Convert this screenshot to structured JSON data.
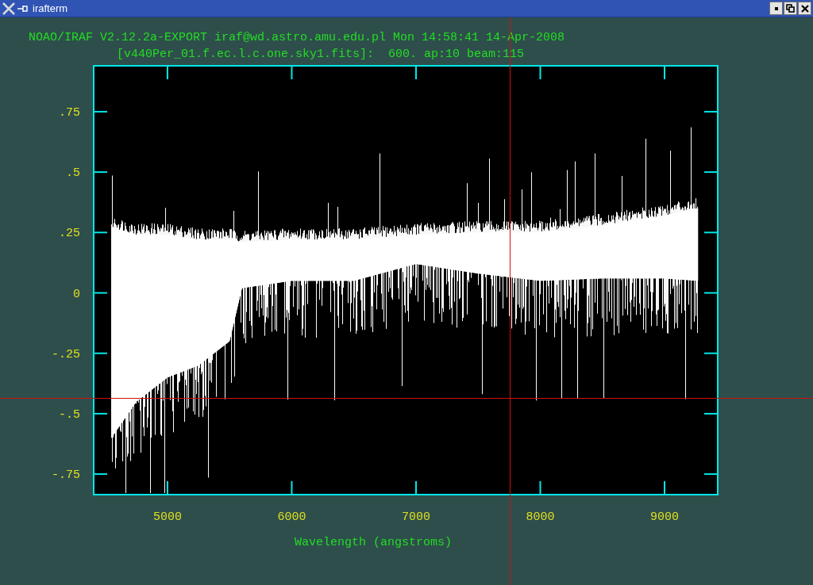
{
  "window": {
    "title": "irafterm"
  },
  "header": {
    "line_1": "NOAO/IRAF V2.12.2a-EXPORT iraf@wd.astro.amu.edu.pl Mon 14:58:41 14-Apr-2008",
    "line_2": "[v440Per_01.f.ec.l.c.one.sky1.fits]:  600. ap:10 beam:115"
  },
  "plot": {
    "chart_data": {
      "type": "line",
      "xlabel": "Wavelength (angstroms)",
      "xlim": [
        4406,
        9428
      ],
      "ylim": [
        -0.835,
        0.94
      ],
      "xticks": [
        5000,
        6000,
        7000,
        8000,
        9000
      ],
      "yticks": [
        {
          "value": 0.75,
          "label": ".75"
        },
        {
          "value": 0.5,
          "label": ".5"
        },
        {
          "value": 0.25,
          "label": ".25"
        },
        {
          "value": 0,
          "label": "0"
        },
        {
          "value": -0.25,
          "label": "-.25"
        },
        {
          "value": -0.5,
          "label": "-.5"
        },
        {
          "value": -0.75,
          "label": "-.75"
        }
      ]
    }
  }
}
